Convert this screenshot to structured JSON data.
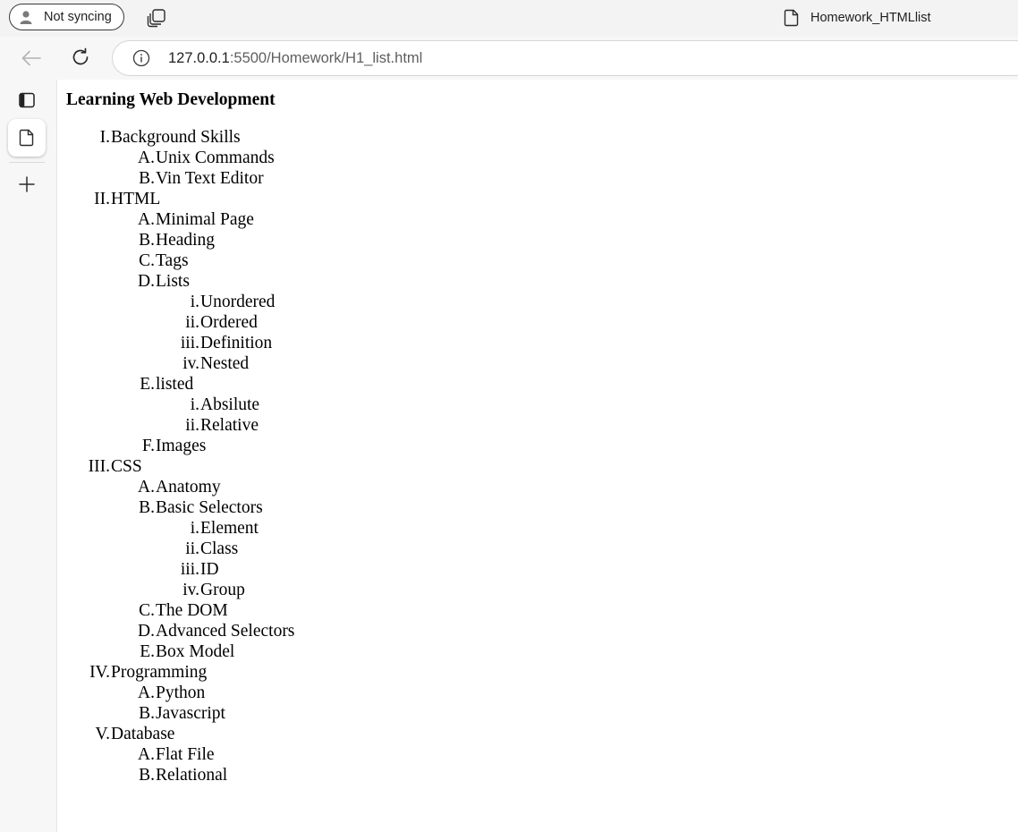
{
  "profile": {
    "label": "Not syncing"
  },
  "tab": {
    "title": "Homework_HTMLlist"
  },
  "address": {
    "host": "127.0.0.1",
    "rest": ":5500/Homework/H1_list.html"
  },
  "page": {
    "heading": "Learning Web Development",
    "outline": [
      {
        "level": 1,
        "marker": "I.",
        "text": "Background Skills"
      },
      {
        "level": 2,
        "marker": "A.",
        "text": "Unix Commands"
      },
      {
        "level": 2,
        "marker": "B.",
        "text": "Vin Text Editor"
      },
      {
        "level": 1,
        "marker": "II.",
        "text": "HTML"
      },
      {
        "level": 2,
        "marker": "A.",
        "text": "Minimal Page"
      },
      {
        "level": 2,
        "marker": "B.",
        "text": "Heading"
      },
      {
        "level": 2,
        "marker": "C.",
        "text": "Tags"
      },
      {
        "level": 2,
        "marker": "D.",
        "text": "Lists"
      },
      {
        "level": 3,
        "marker": "i.",
        "text": "Unordered"
      },
      {
        "level": 3,
        "marker": "ii.",
        "text": "Ordered"
      },
      {
        "level": 3,
        "marker": "iii.",
        "text": "Definition"
      },
      {
        "level": 3,
        "marker": "iv.",
        "text": "Nested"
      },
      {
        "level": 2,
        "marker": "E.",
        "text": "listed"
      },
      {
        "level": 3,
        "marker": "i.",
        "text": "Absilute"
      },
      {
        "level": 3,
        "marker": "ii.",
        "text": "Relative"
      },
      {
        "level": 2,
        "marker": "F.",
        "text": "Images"
      },
      {
        "level": 1,
        "marker": "III.",
        "text": "CSS"
      },
      {
        "level": 2,
        "marker": "A.",
        "text": "Anatomy"
      },
      {
        "level": 2,
        "marker": "B.",
        "text": "Basic Selectors"
      },
      {
        "level": 3,
        "marker": "i.",
        "text": "Element"
      },
      {
        "level": 3,
        "marker": "ii.",
        "text": "Class"
      },
      {
        "level": 3,
        "marker": "iii.",
        "text": "ID"
      },
      {
        "level": 3,
        "marker": "iv.",
        "text": "Group"
      },
      {
        "level": 2,
        "marker": "C.",
        "text": "The DOM"
      },
      {
        "level": 2,
        "marker": "D.",
        "text": "Advanced Selectors"
      },
      {
        "level": 2,
        "marker": "E.",
        "text": "Box Model"
      },
      {
        "level": 1,
        "marker": "IV.",
        "text": "Programming"
      },
      {
        "level": 2,
        "marker": "A.",
        "text": "Python"
      },
      {
        "level": 2,
        "marker": "B.",
        "text": "Javascript"
      },
      {
        "level": 1,
        "marker": "V.",
        "text": "Database"
      },
      {
        "level": 2,
        "marker": "A.",
        "text": "Flat File"
      },
      {
        "level": 2,
        "marker": "B.",
        "text": "Relational"
      }
    ]
  },
  "icons": {
    "profile": "person-icon",
    "tab_actions": "tab-actions-icon",
    "page": "page-icon",
    "back": "back-arrow-icon",
    "reload": "reload-icon",
    "site_info": "info-icon",
    "vertical_tabs": "sidebar-panel-icon",
    "active_tab": "page-icon",
    "new_tab": "plus-icon"
  },
  "colors": {
    "tabstrip_bg": "#f3f3f3",
    "toolbar_bg": "#f7f7f7",
    "url_host": "#1f1f1f",
    "url_rest": "#5f5f5f"
  }
}
